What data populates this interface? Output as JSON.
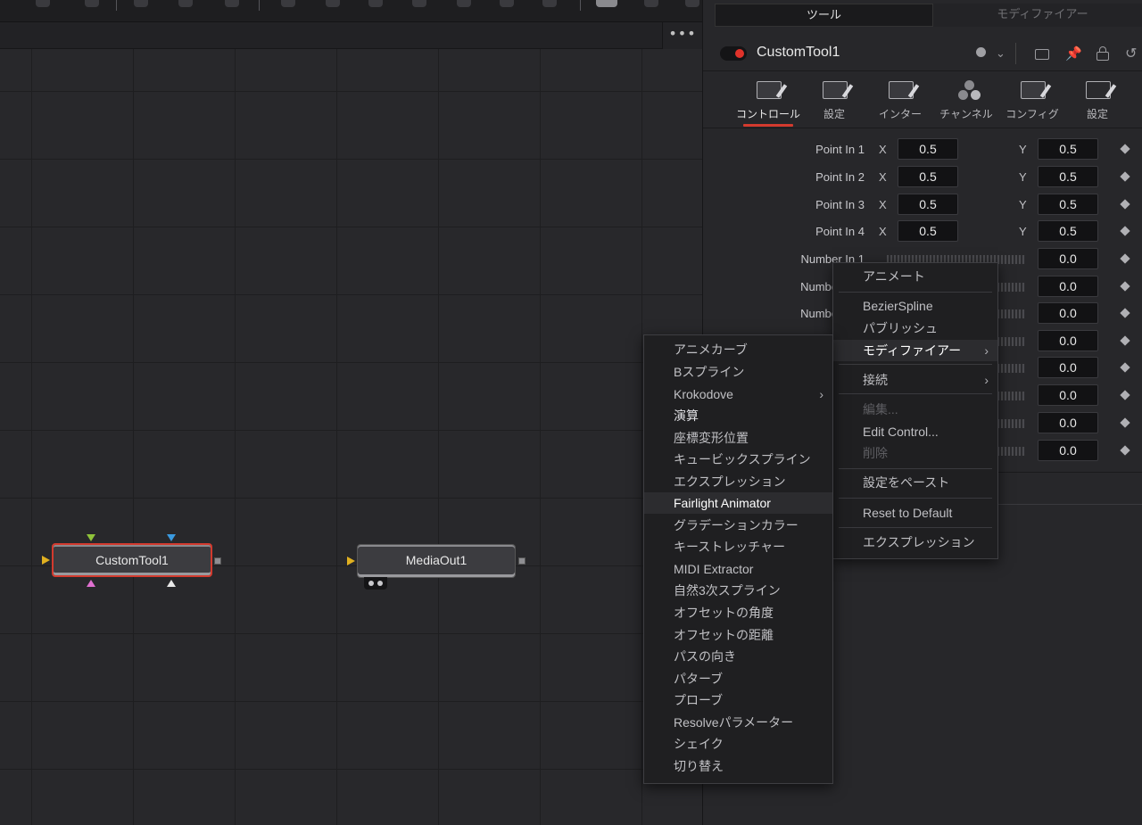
{
  "inspector": {
    "tabs": {
      "tools": "ツール",
      "modifiers": "モディファイアー"
    },
    "tool_name": "CustomTool1",
    "control_tabs": [
      "コントロール",
      "設定",
      "インター",
      "チャンネル",
      "コンフィグ",
      "設定"
    ],
    "params": [
      {
        "label": "Point In 1",
        "x": "0.5",
        "y": "0.5"
      },
      {
        "label": "Point In 2",
        "x": "0.5",
        "y": "0.5"
      },
      {
        "label": "Point In 3",
        "x": "0.5",
        "y": "0.5"
      },
      {
        "label": "Point In 4",
        "x": "0.5",
        "y": "0.5"
      }
    ],
    "axis": {
      "x": "X",
      "y": "Y"
    },
    "numbers": [
      {
        "label": "Number In 1",
        "value": "0.0"
      },
      {
        "label": "Numbe",
        "value": "0.0"
      },
      {
        "label": "Numbe",
        "value": "0.0"
      },
      {
        "label": "",
        "value": "0.0"
      },
      {
        "label": "",
        "value": "0.0"
      },
      {
        "label": "",
        "value": "0.0"
      },
      {
        "label": "",
        "value": "0.0"
      },
      {
        "label": "",
        "value": "0.0"
      }
    ]
  },
  "node_editor": {
    "more_label": "•••",
    "nodes": {
      "custom_tool": "CustomTool1",
      "media_out": "MediaOut1"
    }
  },
  "context_menu": {
    "animate": "アニメート",
    "bezier_spline": "BezierSpline",
    "publish": "パブリッシュ",
    "modifier": "モディファイアー",
    "connect": "接続",
    "edit": "編集...",
    "edit_control": "Edit Control...",
    "delete": "削除",
    "paste_settings": "設定をペースト",
    "reset_default": "Reset to Default",
    "expression": "エクスプレッション"
  },
  "modifier_submenu": {
    "items": [
      "アニメカーブ",
      "Bスプライン",
      "Krokodove",
      "演算",
      "座標変形位置",
      "キュービックスプライン",
      "エクスプレッション",
      "Fairlight Animator",
      "グラデーションカラー",
      "キーストレッチャー",
      "MIDI Extractor",
      "自然3次スプライン",
      "オフセットの角度",
      "オフセットの距離",
      "パスの向き",
      "パターブ",
      "プローブ",
      "Resolveパラメーター",
      "シェイク",
      "切り替え"
    ]
  },
  "colors": {
    "accent_red": "#d33a2e",
    "selection": "#2c2c2f"
  }
}
